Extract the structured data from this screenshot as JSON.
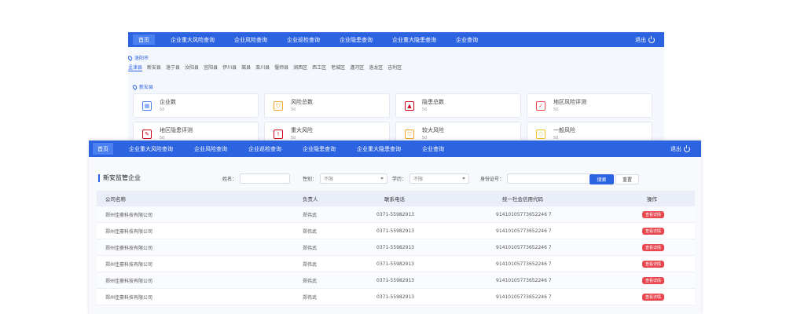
{
  "nav": {
    "home": "首页",
    "items": [
      "企业重大风险查询",
      "企业风险查询",
      "企业巡检查询",
      "企业隐患查询",
      "企业重大隐患查询",
      "企业查询"
    ],
    "logout": "退出"
  },
  "back": {
    "city": "洛阳市",
    "districts": [
      "孟津县",
      "新安县",
      "洛宁县",
      "汝阳县",
      "宜阳县",
      "伊川县",
      "嵩县",
      "栾川县",
      "偃师县",
      "涧西区",
      "西工区",
      "老城区",
      "瀍河区",
      "洛龙区",
      "吉利区"
    ],
    "county": "新安县",
    "cards": [
      {
        "title": "企业数",
        "value": "50",
        "icon": "building-icon",
        "color": "#4b80f0"
      },
      {
        "title": "风险总数",
        "value": "50",
        "icon": "shield-icon",
        "color": "#f5a623"
      },
      {
        "title": "隐患总数",
        "value": "50",
        "icon": "warning-icon",
        "color": "#d0021b"
      },
      {
        "title": "地区风险评测",
        "value": "50",
        "icon": "clipboard-icon",
        "color": "#e8474f"
      },
      {
        "title": "地区隐患评测",
        "value": "50",
        "icon": "document-icon",
        "color": "#d0021b"
      },
      {
        "title": "重大风险",
        "value": "50",
        "icon": "shield-alert-icon",
        "color": "#d0021b"
      },
      {
        "title": "较大风险",
        "value": "50",
        "icon": "shield-icon",
        "color": "#f5a623"
      },
      {
        "title": "一般风险",
        "value": "50",
        "icon": "hexagon-icon",
        "color": "#f5c623"
      }
    ]
  },
  "front": {
    "nav_items": [
      "企业重大风险查询",
      "企业风险查询",
      "企业巡检查询",
      "企业隐患查询",
      "企业重大隐患查询",
      "企业查询"
    ],
    "panel_title": "新安监管企业",
    "filters": {
      "name_label": "姓名：",
      "gender_label": "性别：",
      "gender_value": "不限",
      "edu_label": "学历：",
      "edu_value": "不限",
      "id_label": "身份证号："
    },
    "search": "搜索",
    "reset": "重置",
    "columns": [
      "公司名称",
      "负责人",
      "联系电话",
      "统一社会信用代码",
      "操作"
    ],
    "rows": [
      [
        "郑州佳豪科技有限公司",
        "郑伟武",
        "0371-55982913",
        "91410105773652246 7",
        "查看详情"
      ],
      [
        "郑州佳豪科技有限公司",
        "郑伟武",
        "0371-55982913",
        "91410105773652246 7",
        "查看详情"
      ],
      [
        "郑州佳豪科技有限公司",
        "郑伟武",
        "0371-55982913",
        "91410105773652246 7",
        "查看详情"
      ],
      [
        "郑州佳豪科技有限公司",
        "郑伟武",
        "0371-55982913",
        "91410105773652246 7",
        "查看详情"
      ],
      [
        "郑州佳豪科技有限公司",
        "郑伟武",
        "0371-55982913",
        "91410105773652246 7",
        "查看详情"
      ],
      [
        "郑州佳豪科技有限公司",
        "郑伟武",
        "0371-55982913",
        "91410105773652246 7",
        "查看详情"
      ]
    ]
  }
}
